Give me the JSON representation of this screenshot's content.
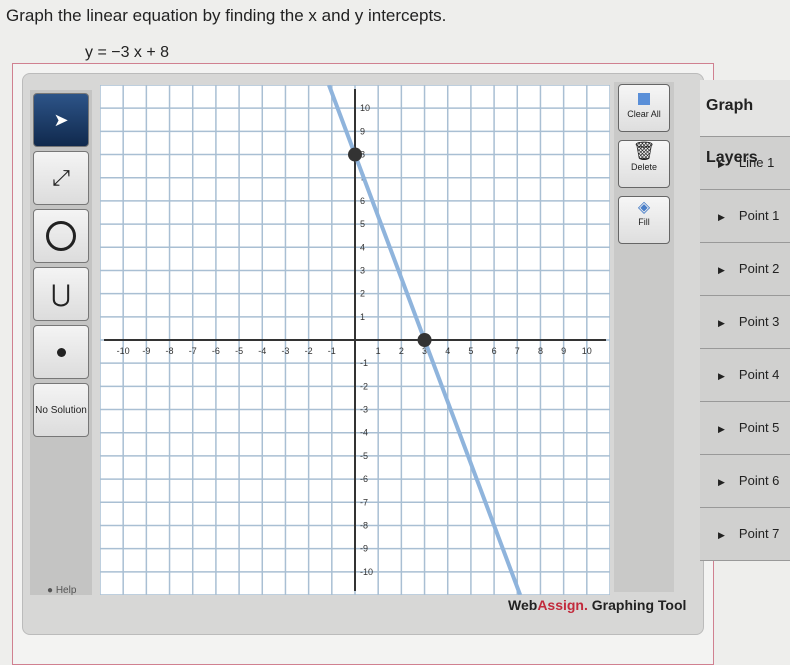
{
  "question": "Graph the linear equation by finding the x and y intercepts.",
  "equation": "y = −3 x + 8",
  "tools": {
    "no_solution": "No Solution",
    "help": "Help"
  },
  "right_tools": {
    "clear_all": "Clear All",
    "delete": "Delete",
    "fill": "Fill"
  },
  "layers": {
    "title": "Graph Layers",
    "items": [
      "Line 1",
      "Point 1",
      "Point 2",
      "Point 3",
      "Point 4",
      "Point 5",
      "Point 6",
      "Point 7"
    ]
  },
  "brand": {
    "web": "Web",
    "assign": "Assign.",
    "rest": " Graphing Tool"
  },
  "graph": {
    "xrange": [
      -11,
      11
    ],
    "yrange": [
      -11,
      11
    ],
    "points": [
      [
        0,
        8
      ],
      [
        3,
        0
      ]
    ],
    "line_color": "#8fb4dc",
    "grid_color": "#a9bfd3"
  }
}
